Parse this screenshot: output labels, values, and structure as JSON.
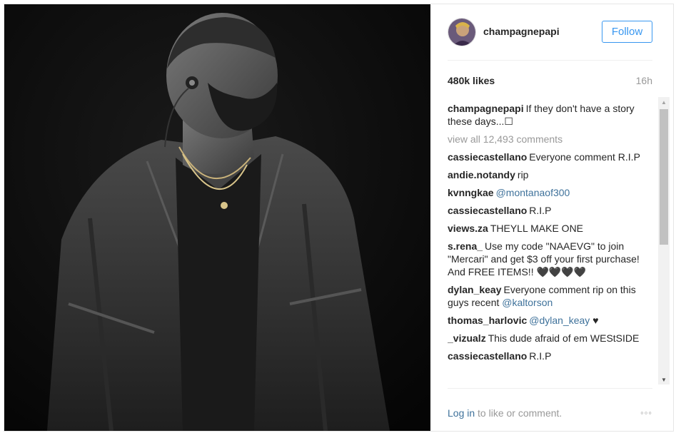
{
  "post": {
    "username": "champagnepapi",
    "follow_label": "Follow",
    "likes": "480k likes",
    "time": "16h",
    "caption_user": "champagnepapi",
    "caption_text": "If they don't have a story these days...☐",
    "view_all": "view all 12,493 comments"
  },
  "comments": [
    {
      "user": "cassiecastellano",
      "text": "Everyone comment R.I.P"
    },
    {
      "user": "andie.notandy",
      "text": "rip"
    },
    {
      "user": "kvnngkae",
      "mention": "@montanaof300"
    },
    {
      "user": "cassiecastellano",
      "text": "R.I.P"
    },
    {
      "user": "views.za",
      "text": "THEYLL MAKE ONE"
    },
    {
      "user": "s.rena_",
      "text": "Use my code \"NAAEVG\" to join \"Mercari\" and get $3 off your first purchase! And FREE ITEMS!! 🖤🖤🖤🖤"
    },
    {
      "user": "dylan_keay",
      "text": "Everyone comment rip on this guys recent ",
      "mention": "@kaltorson"
    },
    {
      "user": "thomas_harlovic",
      "mention": "@dylan_keay",
      "text_after": " ♥"
    },
    {
      "user": "_vizualz",
      "text": "This dude afraid of em WEStSIDE"
    },
    {
      "user": "cassiecastellano",
      "text": "R.I.P"
    }
  ],
  "footer": {
    "login_link": "Log in",
    "login_rest": " to like or comment.",
    "more_icon": "◦◦◦"
  },
  "icons": {
    "more": "more-options-icon",
    "scroll_up": "scroll-up-arrow-icon",
    "scroll_down": "scroll-down-arrow-icon"
  },
  "colors": {
    "accent": "#3897f0",
    "link": "#3f729b",
    "muted": "#999999",
    "text": "#262626"
  }
}
